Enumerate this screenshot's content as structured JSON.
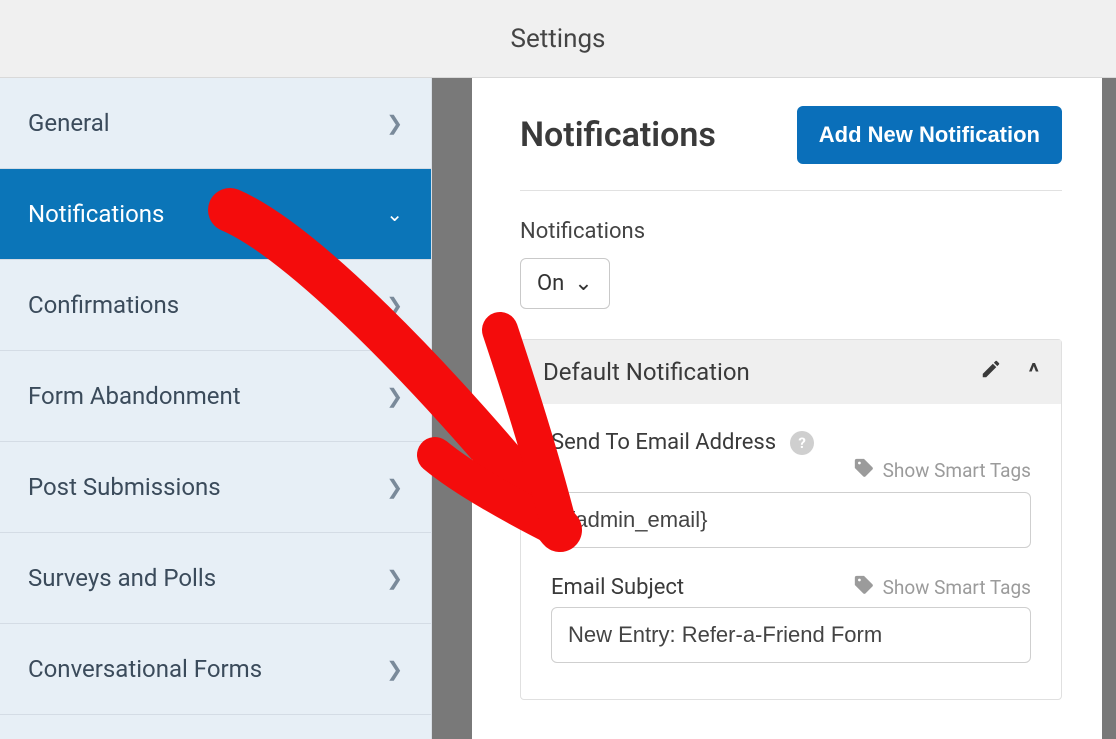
{
  "topbar": {
    "title": "Settings"
  },
  "sidebar": {
    "items": [
      {
        "label": "General"
      },
      {
        "label": "Notifications"
      },
      {
        "label": "Confirmations"
      },
      {
        "label": "Form Abandonment"
      },
      {
        "label": "Post Submissions"
      },
      {
        "label": "Surveys and Polls"
      },
      {
        "label": "Conversational Forms"
      }
    ]
  },
  "main": {
    "title": "Notifications",
    "add_button": "Add New Notification",
    "toggle_label": "Notifications",
    "toggle_value": "On",
    "panel_title": "Default Notification",
    "fields": {
      "send_to": {
        "label": "Send To Email Address",
        "smart": "Show Smart Tags",
        "value": "{admin_email}"
      },
      "subject": {
        "label": "Email Subject",
        "smart": "Show Smart Tags",
        "value": "New Entry: Refer-a-Friend Form"
      }
    }
  }
}
